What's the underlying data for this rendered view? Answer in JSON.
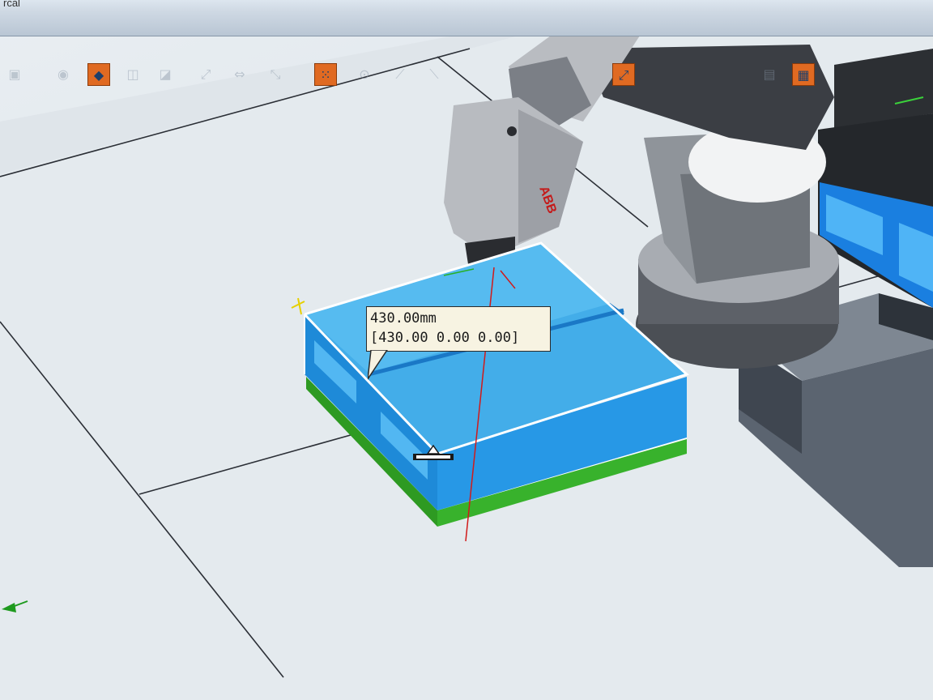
{
  "window": {
    "title_fragment": "rcal"
  },
  "toolbar": {
    "tools": [
      {
        "name": "snap-object-icon",
        "glyph": "▣",
        "active": false
      },
      {
        "name": "snap-center-icon",
        "glyph": "◉",
        "active": false
      },
      {
        "name": "snap-mode-icon",
        "glyph": "◆",
        "active": true
      },
      {
        "name": "snap-edge-icon",
        "glyph": "◫",
        "active": false
      },
      {
        "name": "snap-midpoint-icon",
        "glyph": "◪",
        "active": false
      },
      {
        "name": "snap-end-icon",
        "glyph": "⤢",
        "active": false
      },
      {
        "name": "snap-local-origin-icon",
        "glyph": "⇔",
        "active": false
      },
      {
        "name": "snap-grid-icon",
        "glyph": "⤡",
        "active": false
      },
      {
        "name": "selection-grid-icon",
        "glyph": "⁙",
        "active": true
      },
      {
        "name": "measure-angle-icon",
        "glyph": "⊙",
        "active": false
      },
      {
        "name": "measure-diameter-icon",
        "glyph": "⟋",
        "active": false
      },
      {
        "name": "measure-min-distance-icon",
        "glyph": "⟍",
        "active": false
      },
      {
        "name": "measure-point-to-point-icon",
        "glyph": "⤢",
        "active": true
      },
      {
        "name": "frame-icon",
        "glyph": "▤",
        "active": false
      },
      {
        "name": "stop-measure-icon",
        "glyph": "▦",
        "active": true
      }
    ]
  },
  "measurement": {
    "distance": "430.00mm",
    "vector": "[430.00 0.00 0.00]"
  },
  "robot": {
    "brand_label": "ABB"
  },
  "colors": {
    "workpiece_top": "#3fa9e8",
    "workpiece_side": "#1e88d8",
    "base_plate": "#36b02a",
    "robot_body": "#9a9ea4",
    "robot_dark": "#3a3d42",
    "floor": "#e3e9ee",
    "tooltip_bg": "#f7f3e2",
    "active_tool": "#e06a22"
  }
}
